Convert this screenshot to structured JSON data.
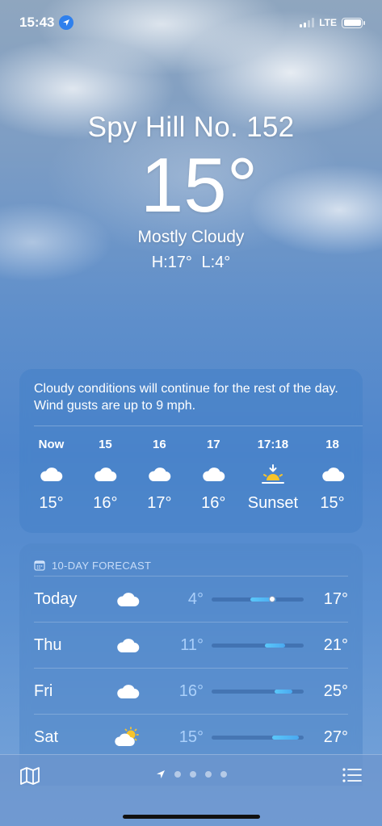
{
  "status_bar": {
    "time": "15:43",
    "network": "LTE"
  },
  "location": {
    "name": "Spy Hill No. 152"
  },
  "current": {
    "temperature": "15°",
    "condition": "Mostly Cloudy",
    "hilo": "H:17°  L:4°"
  },
  "hourly": {
    "summary": "Cloudy conditions will continue for the rest of the day. Wind gusts are up to 9 mph.",
    "items": [
      {
        "label": "Now",
        "icon": "cloud-icon",
        "temp": "15°"
      },
      {
        "label": "15",
        "icon": "cloud-icon",
        "temp": "16°"
      },
      {
        "label": "16",
        "icon": "cloud-icon",
        "temp": "17°"
      },
      {
        "label": "17",
        "icon": "cloud-icon",
        "temp": "16°"
      },
      {
        "label": "17:18",
        "icon": "sunset-icon",
        "temp": "Sunset"
      },
      {
        "label": "18",
        "icon": "cloud-icon",
        "temp": "15°"
      }
    ]
  },
  "forecast": {
    "header": "10-DAY FORECAST",
    "days": [
      {
        "day": "Today",
        "icon": "cloud-icon",
        "low": "4°",
        "high": "17°",
        "bar_start": 0.42,
        "bar_end": 0.7,
        "current_marker": 0.66
      },
      {
        "day": "Thu",
        "icon": "cloud-icon",
        "low": "11°",
        "high": "21°",
        "bar_start": 0.58,
        "bar_end": 0.8
      },
      {
        "day": "Fri",
        "icon": "cloud-icon",
        "low": "16°",
        "high": "25°",
        "bar_start": 0.68,
        "bar_end": 0.88
      },
      {
        "day": "Sat",
        "icon": "partly-sunny-icon",
        "low": "15°",
        "high": "27°",
        "bar_start": 0.66,
        "bar_end": 0.95
      }
    ]
  },
  "colors": {
    "sky_top": "#8fa6bf",
    "sky_bottom": "#5d92d2",
    "location_dot": "#2f80ed",
    "sun": "#f7c42b"
  }
}
